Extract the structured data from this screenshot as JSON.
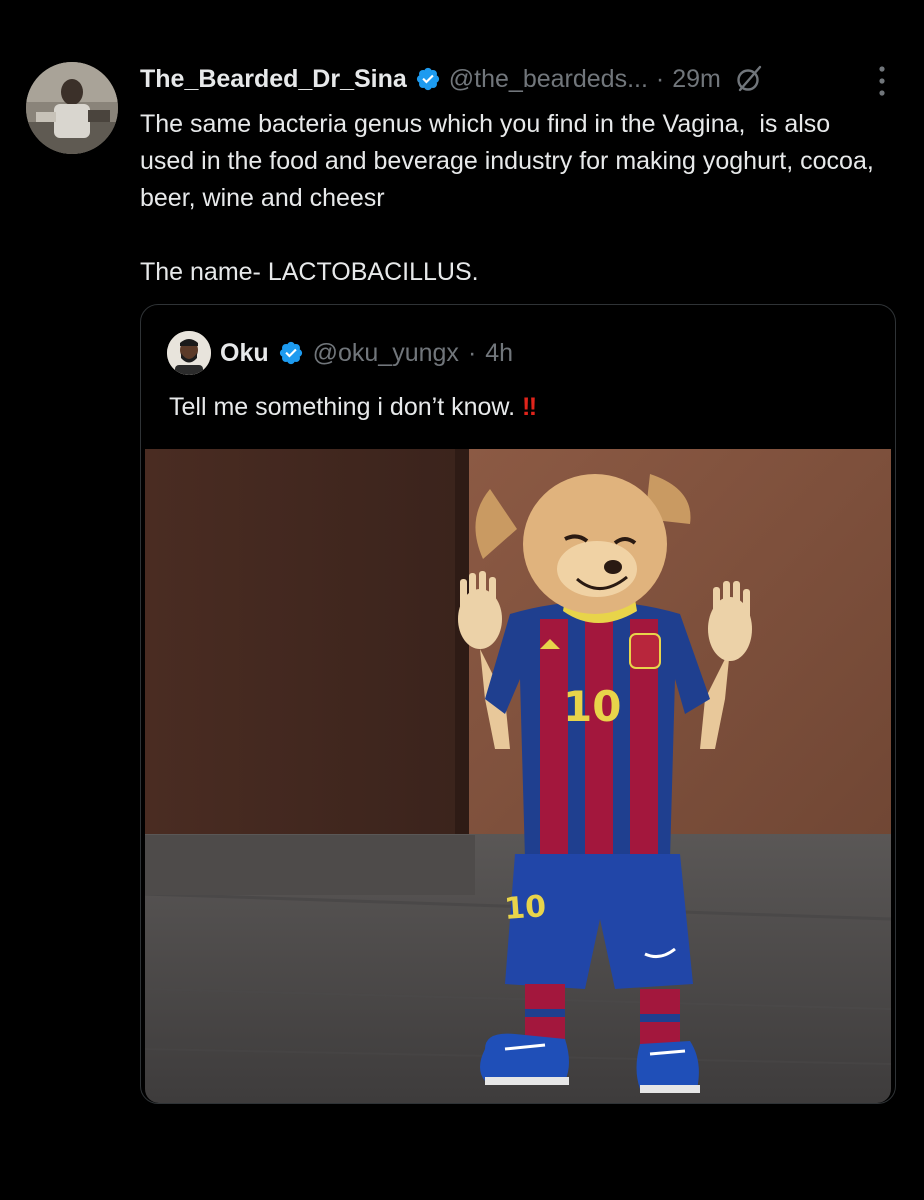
{
  "tweet": {
    "display_name": "The_Bearded_Dr_Sina",
    "handle": "@the_beardeds...",
    "separator": "·",
    "time": "29m",
    "text": "The same bacteria genus which you find in the Vagina,  is also used in the food and beverage industry for making yoghurt, cocoa, beer, wine and cheesr\n\nThe name- LACTOBACILLUS."
  },
  "quoted_tweet": {
    "display_name": "Oku",
    "handle": "@oku_yungx",
    "separator": "·",
    "time": "4h",
    "text": "Tell me something i don’t know.",
    "emoji": "‼",
    "media": {
      "jersey_number": "10",
      "shorts_number": "10"
    }
  },
  "colors": {
    "background": "#000000",
    "text_primary": "#e7e9ea",
    "text_secondary": "#71767b",
    "verified_blue": "#1d9bf0",
    "border": "#2f3336",
    "emoji_red": "#e0241b"
  },
  "icons": {
    "verified": "verified-badge-icon",
    "grok": "grok-icon",
    "more": "more-options-icon"
  }
}
